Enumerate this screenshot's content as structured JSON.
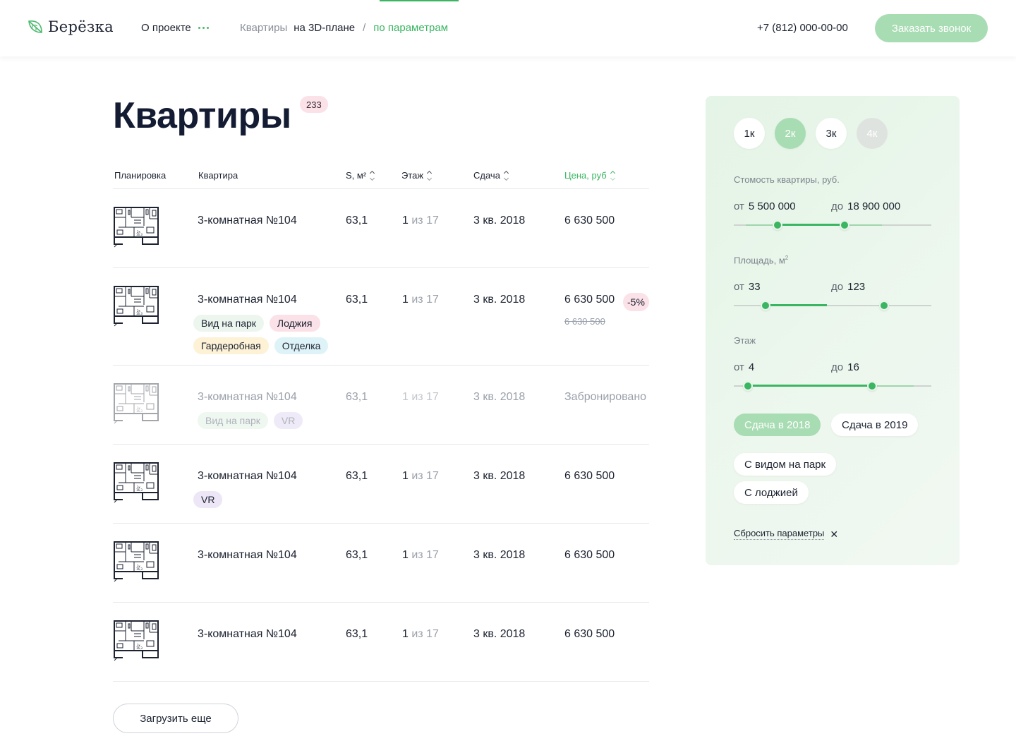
{
  "header": {
    "logo_text": "Берёзка",
    "about_label": "О проекте",
    "breadcrumbs": {
      "apartments": "Квартиры",
      "on_3d": "на 3D-плане",
      "separator": "/",
      "by_params": "по параметрам"
    },
    "phone": "+7 (812) 000-00-00",
    "call_button": "Заказать звонок"
  },
  "page": {
    "title": "Квартиры",
    "count": "233"
  },
  "table": {
    "columns": {
      "plan": "Планировка",
      "apartment": "Квартира",
      "area": "S, м²",
      "floor": "Этаж",
      "delivery": "Сдача",
      "price": "Цена, руб"
    },
    "floor_of": "из",
    "rows": [
      {
        "name": "3-комнатная №104",
        "area": "63,1",
        "floor": "1",
        "floors_total": "17",
        "delivery": "3 кв. 2018",
        "price": "6 630 500"
      },
      {
        "name": "3-комнатная №104",
        "area": "63,1",
        "floor": "1",
        "floors_total": "17",
        "delivery": "3 кв. 2018",
        "price": "6 630 500",
        "discount": "-5%",
        "old_price": "6 630 500",
        "tags": [
          "Вид на парк",
          "Лоджия",
          "Гардеробная",
          "Отделка"
        ]
      },
      {
        "name": "3-комнатная №104",
        "area": "63,1",
        "floor": "1",
        "floors_total": "17",
        "delivery": "3 кв. 2018",
        "price": "Забронировано",
        "booked": true,
        "tags": [
          "Вид на парк",
          "VR"
        ]
      },
      {
        "name": "3-комнатная №104",
        "area": "63,1",
        "floor": "1",
        "floors_total": "17",
        "delivery": "3 кв. 2018",
        "price": "6 630 500",
        "tags": [
          "VR"
        ]
      },
      {
        "name": "3-комнатная №104",
        "area": "63,1",
        "floor": "1",
        "floors_total": "17",
        "delivery": "3 кв. 2018",
        "price": "6 630 500"
      },
      {
        "name": "3-комнатная №104",
        "area": "63,1",
        "floor": "1",
        "floors_total": "17",
        "delivery": "3 кв. 2018",
        "price": "6 630 500"
      }
    ],
    "load_more": "Загрузить еще"
  },
  "filters": {
    "rooms": [
      {
        "label": "1к",
        "state": "normal"
      },
      {
        "label": "2к",
        "state": "selected"
      },
      {
        "label": "3к",
        "state": "normal"
      },
      {
        "label": "4к",
        "state": "disabled"
      }
    ],
    "from_label": "от",
    "to_label": "до",
    "price": {
      "label": "Стомость квартиры, руб.",
      "from": "5 500 000",
      "to": "18 900 000",
      "knob_low": 0.22,
      "knob_high": 0.56
    },
    "area": {
      "label": "Площадь, м",
      "label_sup": "2",
      "from": "33",
      "to": "123",
      "knob_low": 0.16,
      "knob_high": 0.76
    },
    "floor": {
      "label": "Этаж",
      "from": "4",
      "to": "16",
      "knob_low": 0.07,
      "knob_high": 0.7
    },
    "delivery_options": [
      {
        "label": "Сдача в 2018",
        "selected": true
      },
      {
        "label": "Сдача в 2019",
        "selected": false
      }
    ],
    "features": [
      {
        "label": "С видом на парк"
      },
      {
        "label": "С лоджией"
      }
    ],
    "reset_label": "Сбросить параметры",
    "reset_icon": "close-icon"
  },
  "colors": {
    "accent": "#3ab561",
    "accent_light": "#a8dcb3",
    "panel_bg": "#e8f5ea",
    "badge_pink": "#fbe1e8"
  }
}
